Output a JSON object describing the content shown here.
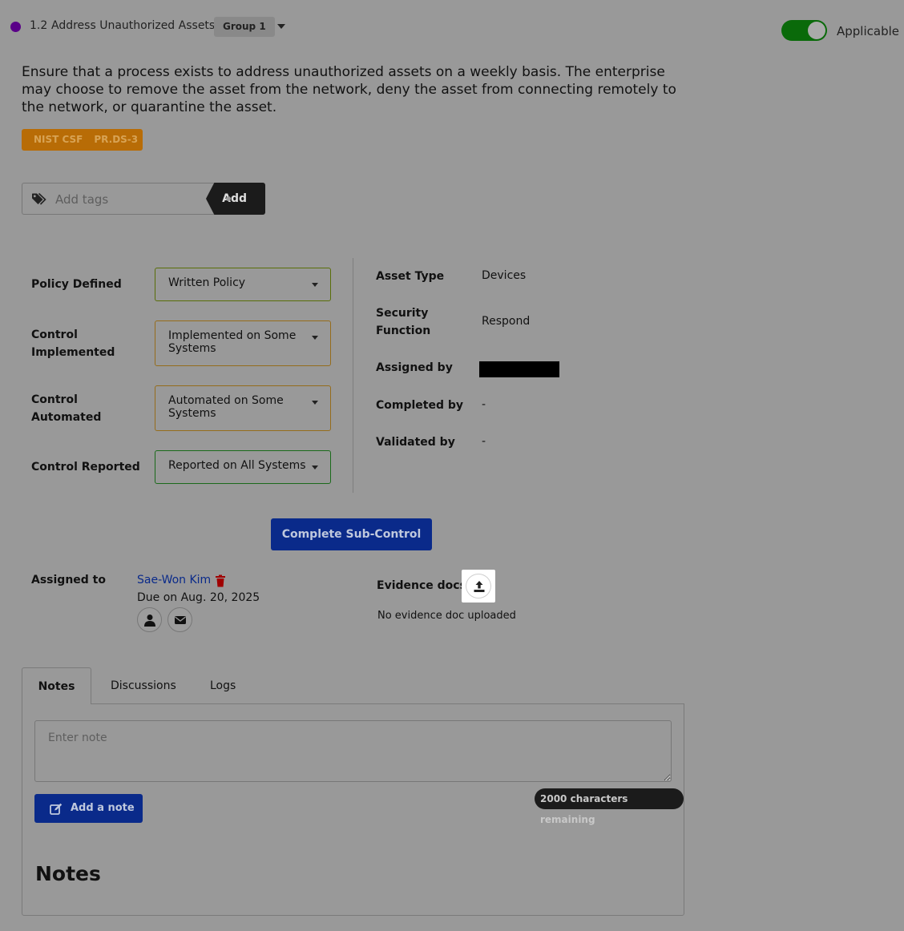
{
  "header": {
    "control_number": "1.2",
    "control_title": "Address Unauthorized Assets",
    "group": "Group 1",
    "applicable_label": "Applicable",
    "applicable_on": true
  },
  "description": "Ensure that a process exists to address unauthorized assets on a weekly basis. The enterprise may choose to remove the asset from the network, deny the asset from connecting remotely to the network, or quarantine the asset.",
  "framework": {
    "name": "NIST CSF",
    "ref": "PR.DS-3"
  },
  "tags": {
    "placeholder": "Add tags",
    "add_label": "Add"
  },
  "properties": [
    {
      "label": "Policy Defined",
      "value": "Written Policy"
    },
    {
      "label": "Control Implemented",
      "value": "Implemented on Some Systems"
    },
    {
      "label": "Control Automated",
      "value": "Automated on Some Systems"
    },
    {
      "label": "Control Reported",
      "value": "Reported on All Systems"
    }
  ],
  "details": [
    {
      "label": "Asset Type",
      "value": "Devices"
    },
    {
      "label": "Security Function",
      "value": "Respond"
    },
    {
      "label": "Assigned by",
      "value": ""
    },
    {
      "label": "Completed by",
      "value": "-"
    },
    {
      "label": "Validated by",
      "value": "-"
    }
  ],
  "complete_button": "Complete Sub-Control",
  "assignment": {
    "label": "Assigned to",
    "assignee": "Sae-Won Kim",
    "due": "Due on Aug. 20, 2025"
  },
  "evidence": {
    "label": "Evidence docs",
    "status": "No evidence doc uploaded"
  },
  "tabs": [
    "Notes",
    "Discussions",
    "Logs"
  ],
  "notes": {
    "placeholder": "Enter note",
    "remaining": "2000 characters remaining",
    "add_label": "Add a note",
    "heading": "Notes"
  },
  "colors": {
    "overlay_bg": "#999999",
    "primary_button": "#0a2a8a",
    "toggle_on": "#0a6a0a",
    "framework_badge": "#b86c06",
    "status_dot": "#5a0088",
    "trash": "#a00000"
  }
}
